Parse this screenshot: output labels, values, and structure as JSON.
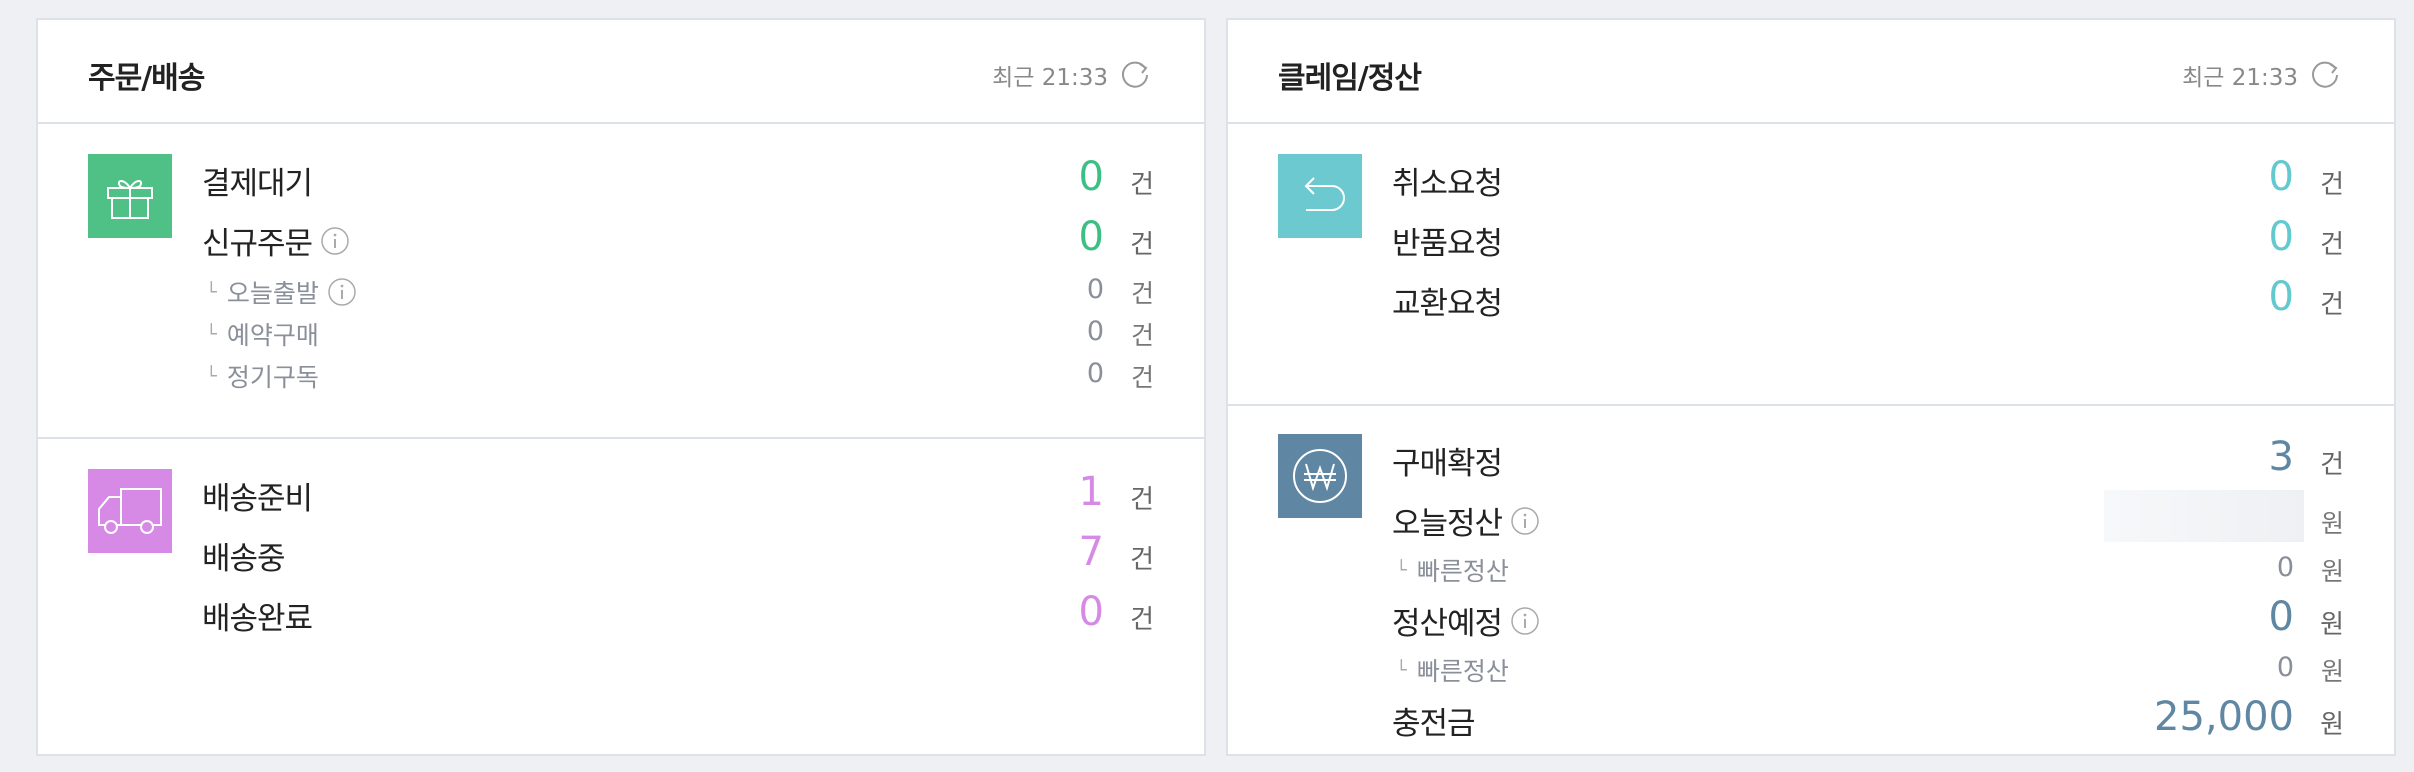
{
  "orders": {
    "title": "주문/배송",
    "updated": "최근 21:33",
    "payment": {
      "icon": "gift-icon",
      "icon_color": "#4fc187",
      "rows": [
        {
          "label": "결제대기",
          "value": "0",
          "unit": "건"
        },
        {
          "label": "신규주문",
          "value": "0",
          "unit": "건"
        }
      ],
      "subrows": [
        {
          "label": "오늘출발",
          "value": "0",
          "unit": "건"
        },
        {
          "label": "예약구매",
          "value": "0",
          "unit": "건"
        },
        {
          "label": "정기구독",
          "value": "0",
          "unit": "건"
        }
      ]
    },
    "shipping": {
      "icon": "truck-icon",
      "icon_color": "#d68ae6",
      "rows": [
        {
          "label": "배송준비",
          "value": "1",
          "unit": "건"
        },
        {
          "label": "배송중",
          "value": "7",
          "unit": "건"
        },
        {
          "label": "배송완료",
          "value": "0",
          "unit": "건"
        }
      ]
    }
  },
  "claims": {
    "title": "클레임/정산",
    "updated": "최근 21:33",
    "requests": {
      "icon": "return-arrow-icon",
      "icon_color": "#6cc9d0",
      "rows": [
        {
          "label": "취소요청",
          "value": "0",
          "unit": "건"
        },
        {
          "label": "반품요청",
          "value": "0",
          "unit": "건"
        },
        {
          "label": "교환요청",
          "value": "0",
          "unit": "건"
        }
      ]
    },
    "settlement": {
      "icon": "won-icon",
      "icon_color": "#5f86a3",
      "confirm": {
        "label": "구매확정",
        "value": "3",
        "unit": "건"
      },
      "today": {
        "label": "오늘정산",
        "value": "",
        "unit": "원"
      },
      "today_fast": {
        "label": "빠른정산",
        "value": "0",
        "unit": "원"
      },
      "scheduled": {
        "label": "정산예정",
        "value": "0",
        "unit": "원"
      },
      "scheduled_fast": {
        "label": "빠른정산",
        "value": "0",
        "unit": "원"
      },
      "charge": {
        "label": "충전금",
        "value": "25,000",
        "unit": "원"
      }
    }
  }
}
